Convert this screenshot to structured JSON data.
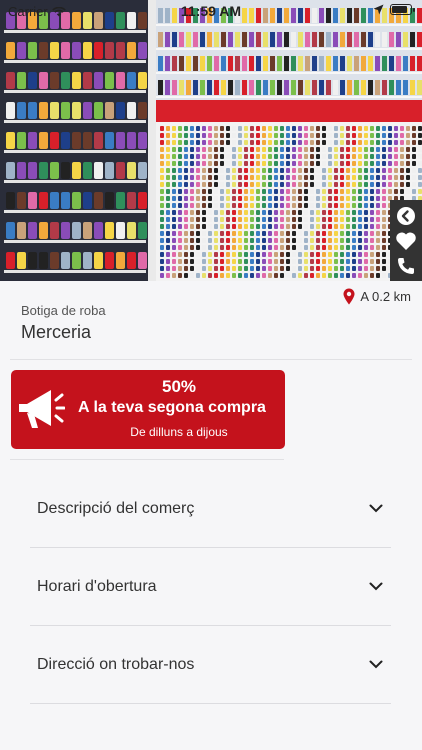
{
  "status_bar": {
    "carrier": "Carrier",
    "time": "11:59 AM",
    "battery_level": 0.9
  },
  "hero": {
    "icons": [
      "back-arrow-icon",
      "heart-icon",
      "phone-icon"
    ]
  },
  "shop": {
    "distance": "A 0.2 km",
    "category": "Botiga de roba",
    "name": "Merceria"
  },
  "promo": {
    "percent": "50%",
    "headline": "A la teva segona compra",
    "days": "De dilluns a dijous",
    "icon": "megaphone-icon",
    "color": "#c4121c"
  },
  "sections": [
    {
      "label": "Descripció del comerç"
    },
    {
      "label": "Horari d'obertura"
    },
    {
      "label": "Direcció on trobar-nos"
    }
  ]
}
